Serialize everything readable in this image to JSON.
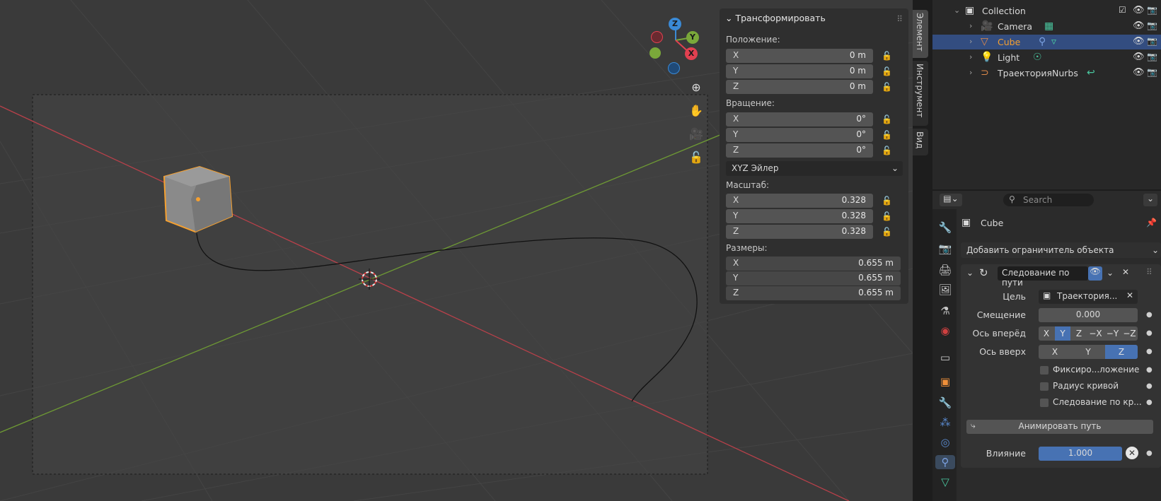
{
  "viewport": {
    "gizmo": {
      "z": "Z",
      "y": "Y",
      "x": "X"
    }
  },
  "npanel": {
    "title": "Трансформировать",
    "location": {
      "label": "Положение:",
      "x": "0 m",
      "y": "0 m",
      "z": "0 m"
    },
    "rotation": {
      "label": "Вращение:",
      "x": "0°",
      "y": "0°",
      "z": "0°"
    },
    "rotation_mode": "XYZ Эйлер",
    "scale": {
      "label": "Масштаб:",
      "x": "0.328",
      "y": "0.328",
      "z": "0.328"
    },
    "dimensions": {
      "label": "Размеры:",
      "x": "0.655 m",
      "y": "0.655 m",
      "z": "0.655 m"
    },
    "axis_x": "X",
    "axis_y": "Y",
    "axis_z": "Z"
  },
  "side_tabs": [
    "Элемент",
    "Инструмент",
    "Вид"
  ],
  "outliner": {
    "collection": "Collection",
    "items": [
      "Camera",
      "Cube",
      "Light",
      "ТраекторияNurbs"
    ]
  },
  "properties": {
    "search_placeholder": "Search",
    "object_name": "Cube",
    "add_constraint": "Добавить ограничитель объекта",
    "constraint_name": "Следование по пути",
    "target_label": "Цель",
    "target_value": "Траектория...",
    "offset_label": "Смещение",
    "offset_value": "0.000",
    "forward_label": "Ось вперёд",
    "forward_options": [
      "X",
      "Y",
      "Z",
      "−X",
      "−Y",
      "−Z"
    ],
    "up_label": "Ось вверх",
    "up_options": [
      "X",
      "Y",
      "Z"
    ],
    "fixed_position": "Фиксиро...ложение",
    "curve_radius": "Радиус кривой",
    "follow_curve": "Следование по кр...",
    "animate_path": "Анимировать путь",
    "influence_label": "Влияние",
    "influence_value": "1.000"
  },
  "colors": {
    "selection_orange": "#f5a030",
    "active_blue": "#4772b3",
    "axis_x": "#e24050",
    "axis_y": "#7aa83a",
    "axis_z": "#3a8ad6"
  }
}
